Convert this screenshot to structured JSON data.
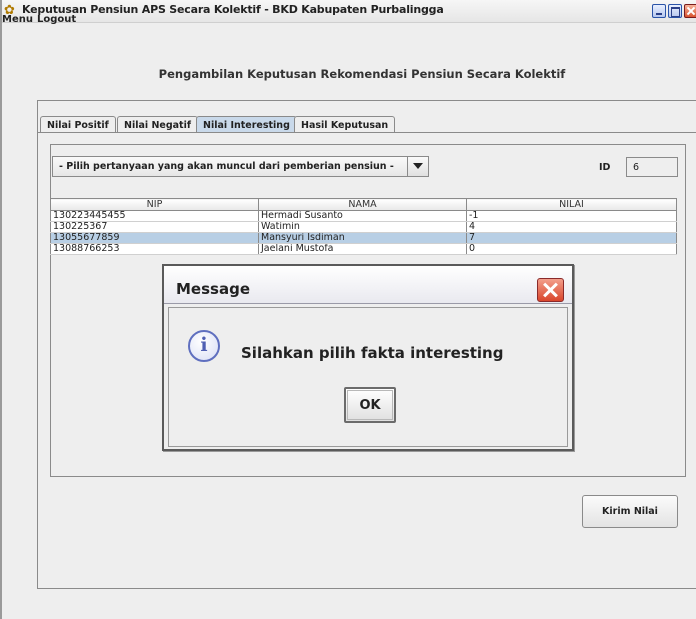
{
  "window": {
    "title": "Keputusan Pensiun APS Secara Kolektif - BKD Kabupaten Purbalingga",
    "icon": "app-logo-icon"
  },
  "menu": {
    "items": [
      "Menu",
      "Logout"
    ]
  },
  "heading": "Pengambilan Keputusan Rekomendasi Pensiun Secara Kolektif",
  "tabs": [
    {
      "label": "Nilai Positif",
      "active": false
    },
    {
      "label": "Nilai Negatif",
      "active": false
    },
    {
      "label": "Nilai Interesting",
      "active": true
    },
    {
      "label": "Hasil Keputusan",
      "active": false
    }
  ],
  "question_select": {
    "value": "- Pilih pertanyaan yang akan muncul dari pemberian pensiun -"
  },
  "id_field": {
    "label": "ID",
    "value": "6"
  },
  "table": {
    "columns": [
      "NIP",
      "NAMA",
      "NILAI"
    ],
    "rows": [
      [
        "130223445455",
        "Hermadi Susanto",
        "-1"
      ],
      [
        "130225367",
        "Watimin",
        "4"
      ],
      [
        "13055677859",
        "Mansyuri Isdiman",
        "7"
      ],
      [
        "13088766253",
        "Jaelani Mustofa",
        "0"
      ]
    ],
    "selected_row": 2
  },
  "kirim_button": "Kirim Nilai",
  "dialog": {
    "title": "Message",
    "message": "Silahkan pilih fakta interesting",
    "ok": "OK"
  },
  "colors": {
    "selection": "#b8cfe5",
    "active_tab": "#c9d9ea",
    "close_button": "#d9452b"
  }
}
